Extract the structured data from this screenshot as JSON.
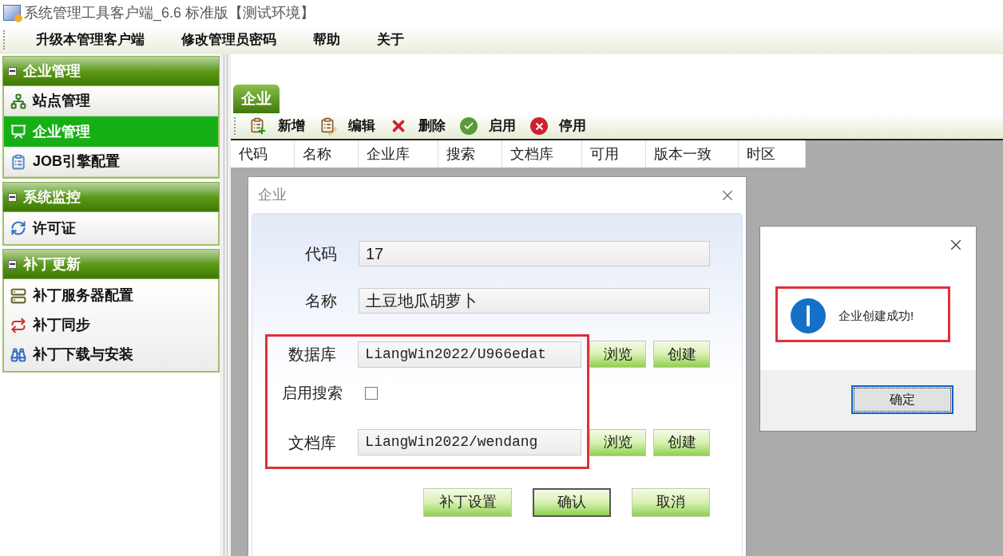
{
  "window": {
    "title": "系统管理工具客户端_6.6 标准版【测试环境】"
  },
  "menu": [
    "升级本管理客户端",
    "修改管理员密码",
    "帮助",
    "关于"
  ],
  "sidebar": {
    "groups": [
      {
        "title": "企业管理",
        "expanded": true,
        "items": [
          {
            "label": "站点管理",
            "selected": false
          },
          {
            "label": "企业管理",
            "selected": true
          },
          {
            "label": "JOB引擎配置",
            "selected": false
          }
        ]
      },
      {
        "title": "系统监控",
        "expanded": true,
        "items": [
          {
            "label": "许可证",
            "selected": false
          }
        ]
      },
      {
        "title": "补丁更新",
        "expanded": true,
        "items": [
          {
            "label": "补丁服务器配置",
            "selected": false
          },
          {
            "label": "补丁同步",
            "selected": false
          },
          {
            "label": "补丁下载与安装",
            "selected": false
          }
        ]
      }
    ]
  },
  "tabs": [
    {
      "label": "企业",
      "selected": true
    }
  ],
  "toolbar": [
    {
      "label": "新增",
      "kind": "add"
    },
    {
      "label": "编辑",
      "kind": "edit"
    },
    {
      "label": "删除",
      "kind": "delete"
    },
    {
      "label": "启用",
      "kind": "enable"
    },
    {
      "label": "停用",
      "kind": "disable"
    }
  ],
  "table": {
    "columns": [
      "代码",
      "名称",
      "企业库",
      "搜索",
      "文档库",
      "可用",
      "版本一致",
      "时区"
    ]
  },
  "dialog": {
    "title": "企业",
    "fields": [
      {
        "kind": "text",
        "label": "代码",
        "value": "17"
      },
      {
        "kind": "text",
        "label": "名称",
        "value": "土豆地瓜胡萝卜"
      },
      {
        "kind": "path",
        "label": "数据库",
        "value": "LiangWin2022/U966edat",
        "buttons": [
          "浏览",
          "创建"
        ]
      },
      {
        "kind": "checkbox",
        "label": "启用搜索",
        "checked": false
      },
      {
        "kind": "path",
        "label": "文档库",
        "value": "LiangWin2022/wendang",
        "buttons": [
          "浏览",
          "创建"
        ]
      }
    ],
    "buttons": [
      {
        "label": "补丁设置",
        "focused": false
      },
      {
        "label": "确认",
        "focused": true
      },
      {
        "label": "取消",
        "focused": false
      }
    ]
  },
  "message": {
    "text": "企业创建成功!",
    "button": {
      "label": "确定",
      "focused": true
    }
  }
}
